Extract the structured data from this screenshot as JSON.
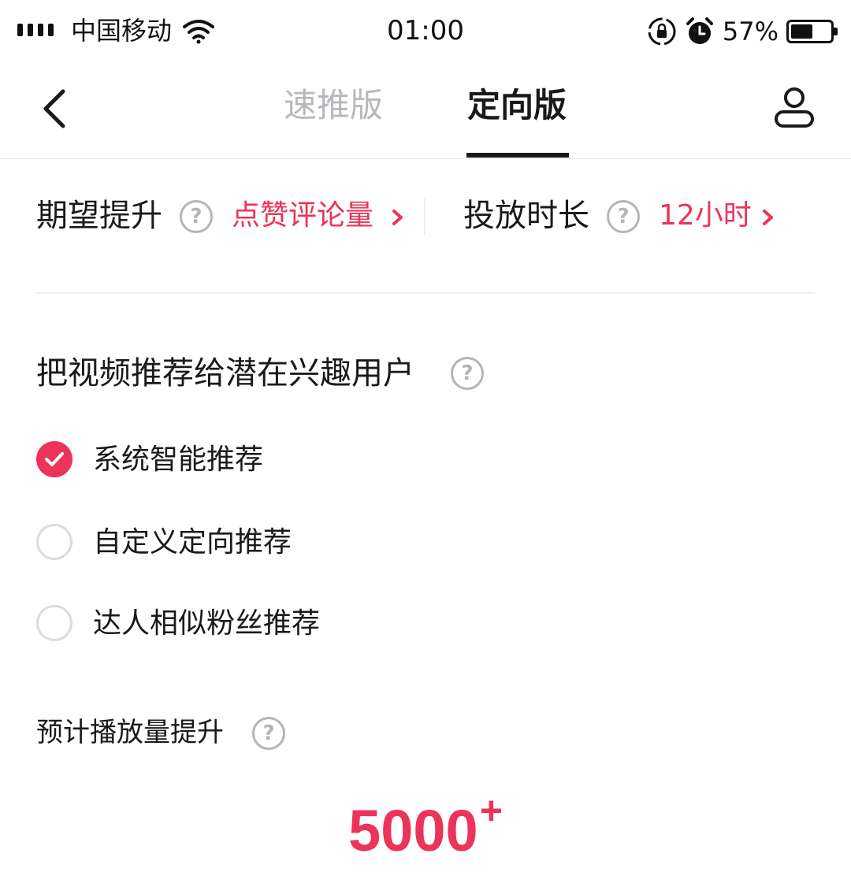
{
  "status_bar": {
    "carrier": "中国移动",
    "time": "01:00",
    "battery_percent": "57%",
    "battery_level": 0.57
  },
  "nav": {
    "tabs": [
      {
        "label": "速推版",
        "active": false
      },
      {
        "label": "定向版",
        "active": true
      }
    ],
    "icons": [
      "back-arrow-icon",
      "profile-icon"
    ]
  },
  "settings": {
    "expect_label": "期望提升",
    "expect_value": "点赞评论量",
    "duration_label": "投放时长",
    "duration_value": "12小时",
    "help_glyph": "?"
  },
  "targeting": {
    "title": "把视频推荐给潜在兴趣用户",
    "options": [
      {
        "label": "系统智能推荐",
        "checked": true
      },
      {
        "label": "自定义定向推荐",
        "checked": false
      },
      {
        "label": "达人相似粉丝推荐",
        "checked": false
      }
    ]
  },
  "estimate": {
    "label": "预计播放量提升",
    "value": "5000",
    "suffix": "+"
  },
  "colors": {
    "accent": "#ec3359",
    "inactive_tab": "#b8b8bc"
  }
}
